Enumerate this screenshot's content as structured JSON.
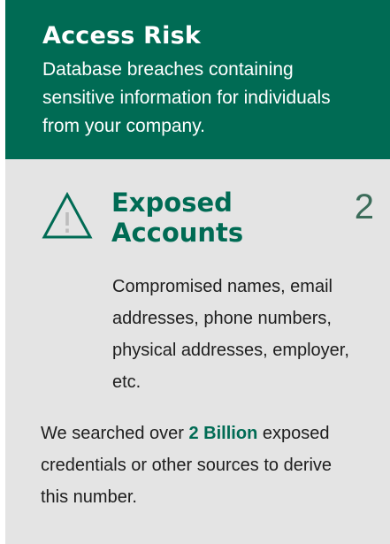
{
  "header": {
    "title": "Access Risk",
    "description": "Database breaches containing sensitive information for individuals from your company."
  },
  "metric": {
    "icon": "warning-icon",
    "title": "Exposed Accounts",
    "value": "2",
    "description": "Compromised names, email addresses, phone numbers, physical addresses, employer, etc."
  },
  "note": {
    "prefix": "We searched over ",
    "highlight": "2 Billion",
    "suffix": " exposed credentials or other sources to derive this number."
  },
  "colors": {
    "header_bg": "#006b54",
    "body_bg": "#e4e4e4",
    "accent": "#006b54",
    "icon_mark": "#bdbdbd",
    "value_text": "#3c6c5a"
  }
}
